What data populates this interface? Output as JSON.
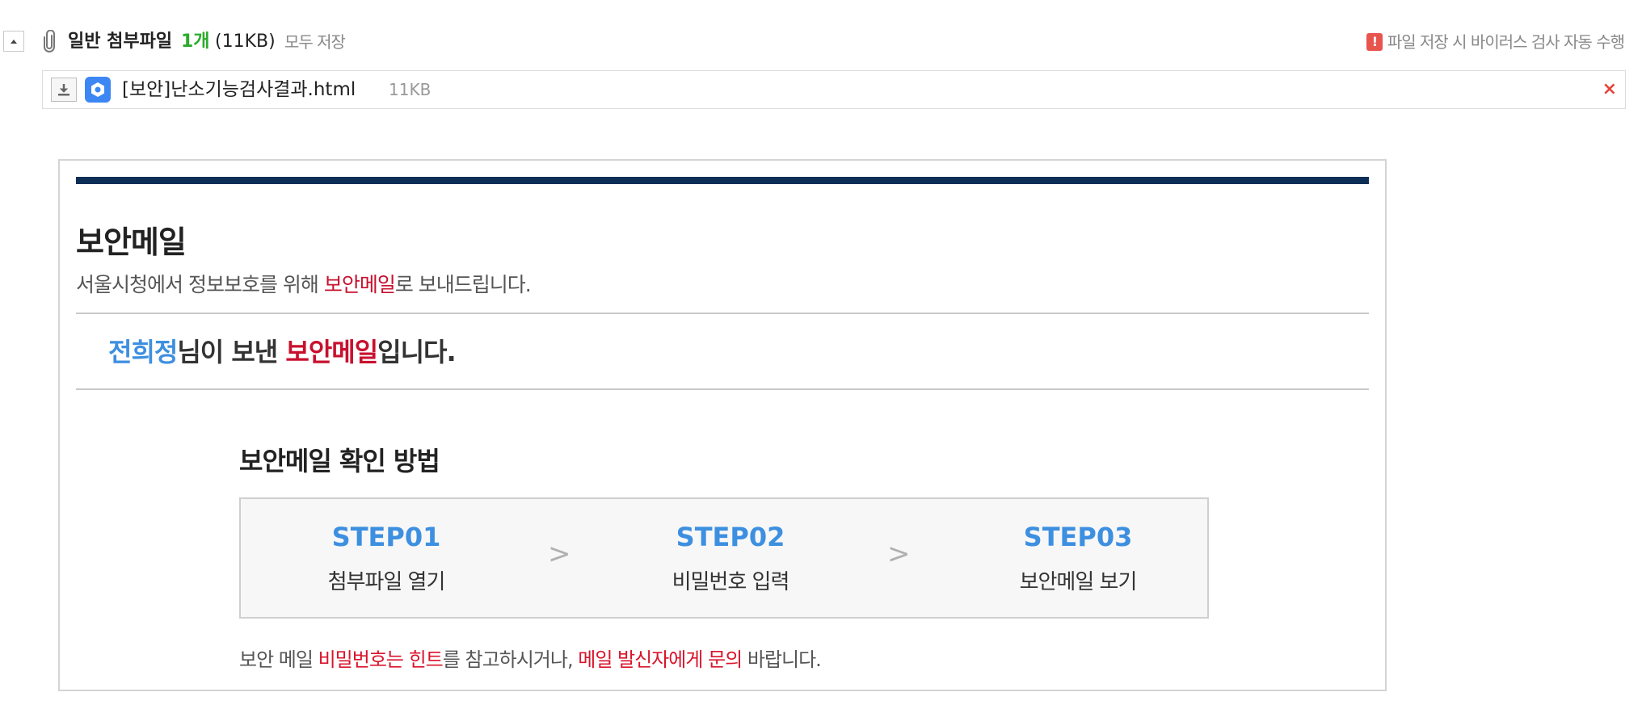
{
  "attachments": {
    "title": "일반 첨부파일",
    "count": "1개",
    "total_size": "(11KB)",
    "save_all_label": "모두 저장",
    "virus_note": "파일 저장 시 바이러스 검사 자동 수행",
    "files": [
      {
        "name": "[보안]난소기능검사결과.html",
        "size": "11KB",
        "remove_label": "×"
      }
    ]
  },
  "mail": {
    "title": "보안메일",
    "desc_prefix": "서울시청에서 정보보호를 위해 ",
    "desc_highlight": "보안메일",
    "desc_suffix": "로 보내드립니다.",
    "sender_name": "전희정",
    "sender_mid": "님이 보낸 ",
    "sender_highlight": "보안메일",
    "sender_suffix": "입니다.",
    "method_title": "보안메일 확인 방법",
    "steps": [
      {
        "num": "STEP01",
        "label": "첨부파일 열기"
      },
      {
        "num": "STEP02",
        "label": "비밀번호 입력"
      },
      {
        "num": "STEP03",
        "label": "보안메일 보기"
      }
    ],
    "step_separator": ">",
    "hint_prefix": "보안 메일 ",
    "hint_red1": "비밀번호는 힌트",
    "hint_mid": "를 참고하시거나, ",
    "hint_red2": "메일 발신자에게 문의",
    "hint_suffix": " 바랍니다."
  },
  "colors": {
    "accent_green": "#2bab2b",
    "accent_red": "#c8102e",
    "accent_blue": "#3d8fe0",
    "top_bar": "#0d2f57"
  },
  "icons": {
    "collapse": "triangle-up-icon",
    "attachment": "paperclip-icon",
    "alert": "alert-icon",
    "download": "download-icon",
    "app": "hexagon-app-icon",
    "remove": "close-icon"
  }
}
